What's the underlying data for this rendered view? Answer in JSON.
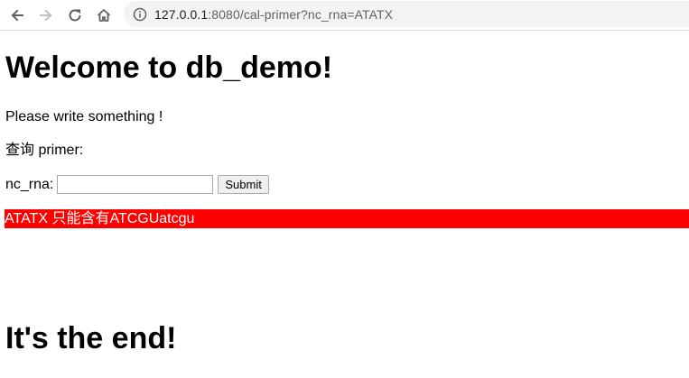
{
  "browser": {
    "url_host": "127.0.0.1",
    "url_rest": ":8080/cal-primer?nc_rna=ATATX"
  },
  "page": {
    "title": "Welcome to db_demo!",
    "intro": "Please write something !",
    "query_label": "查询 primer:",
    "field_label": "nc_rna:",
    "field_value": "",
    "submit_label": "Submit",
    "error_message": "ATATX 只能含有ATCGUatcgu",
    "footer_title": "It's the end!"
  },
  "colors": {
    "error_bg": "#ff0000",
    "error_text": "#ffffff"
  }
}
